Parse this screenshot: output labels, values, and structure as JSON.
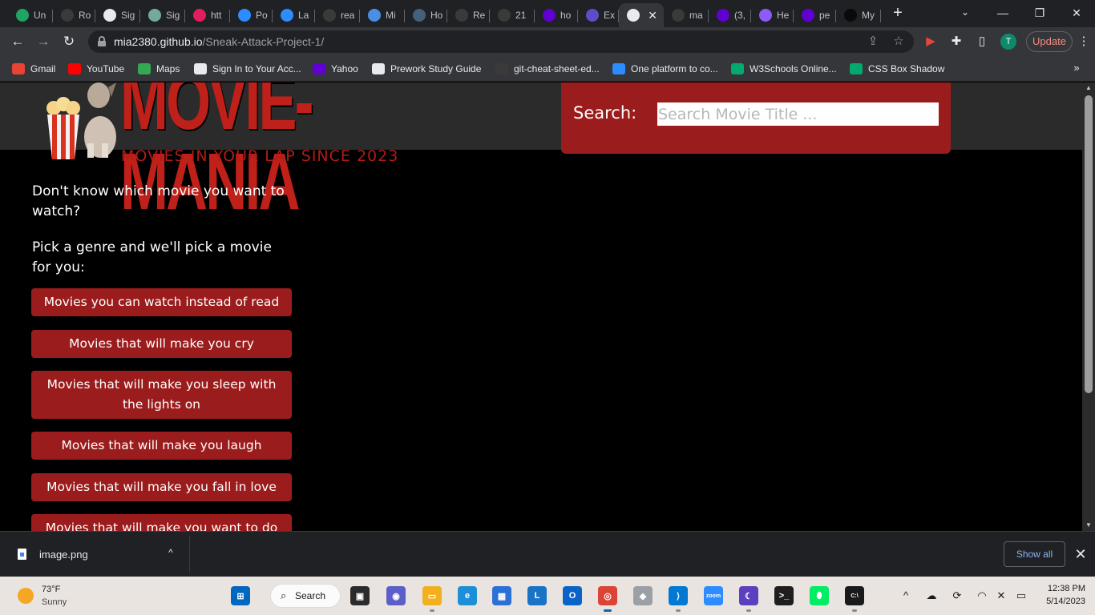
{
  "browser": {
    "tabs": [
      {
        "title": "Un",
        "icon": "google-drive-icon",
        "color": "#1fa463"
      },
      {
        "title": "Ro",
        "icon": "github-icon",
        "color": "#3a3a3a"
      },
      {
        "title": "Sig",
        "icon": "globe-icon",
        "color": "#e8eaed"
      },
      {
        "title": "Sig",
        "icon": "openai-icon",
        "color": "#74aa9c"
      },
      {
        "title": "htt",
        "icon": "slack-icon",
        "color": "#e01e5a"
      },
      {
        "title": "Po",
        "icon": "zoom-icon",
        "color": "#2d8cff"
      },
      {
        "title": "La",
        "icon": "zoom-icon",
        "color": "#2d8cff"
      },
      {
        "title": "rea",
        "icon": "github-icon",
        "color": "#3a3a3a"
      },
      {
        "title": "Mi",
        "icon": "cube-icon",
        "color": "#4a90e2"
      },
      {
        "title": "Ho",
        "icon": "bookmark-icon",
        "color": "#44607a"
      },
      {
        "title": "Re",
        "icon": "github-icon",
        "color": "#3a3a3a"
      },
      {
        "title": "21",
        "icon": "github-icon",
        "color": "#3a3a3a"
      },
      {
        "title": "ho",
        "icon": "yahoo-icon",
        "color": "#6001d2"
      },
      {
        "title": "Ex",
        "icon": "a-circle-icon",
        "color": "#5b4fc9"
      },
      {
        "title": "",
        "icon": "globe-icon",
        "color": "#e8eaed",
        "active": true
      },
      {
        "title": "ma",
        "icon": "github-icon",
        "color": "#3a3a3a"
      },
      {
        "title": "(3,",
        "icon": "yahoo-mail-icon",
        "color": "#6001d2"
      },
      {
        "title": "He",
        "icon": "h-icon",
        "color": "#8b5cf6"
      },
      {
        "title": "pe",
        "icon": "yahoo-icon",
        "color": "#6001d2"
      },
      {
        "title": "My",
        "icon": "dev-icon",
        "color": "#0a0a0a"
      }
    ],
    "new_tab": "+",
    "tab_search": "⌄",
    "window_minimize": "—",
    "window_restore": "❐",
    "window_close": "✕",
    "back": "←",
    "forward": "→",
    "reload": "↻",
    "url_host": "mia2380.github.io",
    "url_path": "/Sneak-Attack-Project-1/",
    "share_icon": "⇪",
    "star_icon": "☆",
    "profile_initial": "T",
    "update_label": "Update",
    "menu": "⋮",
    "bookmarks": [
      {
        "label": "Gmail",
        "icon": "gmail-icon",
        "color": "#ea4335"
      },
      {
        "label": "YouTube",
        "icon": "youtube-icon",
        "color": "#ff0000"
      },
      {
        "label": "Maps",
        "icon": "maps-icon",
        "color": "#34a853"
      },
      {
        "label": "Sign In to Your Acc...",
        "icon": "globe-icon",
        "color": "#e8eaed"
      },
      {
        "label": "Yahoo",
        "icon": "yahoo-mail-icon",
        "color": "#6001d2"
      },
      {
        "label": "Prework Study Guide",
        "icon": "globe-icon",
        "color": "#e8eaed"
      },
      {
        "label": "git-cheat-sheet-ed...",
        "icon": "github-icon",
        "color": "#3a3a3a"
      },
      {
        "label": "One platform to co...",
        "icon": "zoom-icon",
        "color": "#2d8cff"
      },
      {
        "label": "W3Schools Online...",
        "icon": "w3schools-icon",
        "color": "#04aa6d"
      },
      {
        "label": "CSS Box Shadow",
        "icon": "w3schools-icon",
        "color": "#04aa6d"
      }
    ],
    "bookmarks_more": "»"
  },
  "page": {
    "logo_title": "MOVIE-MANIA",
    "logo_tagline": "MOVIES IN YOUR LAP SINCE 2023",
    "search_label": "Search:",
    "search_placeholder": "Search Movie Title ...",
    "intro_text": "Don't know which movie you want to watch?",
    "pick_text": "Pick a genre and we'll pick a movie for you:",
    "genres": [
      "Movies you can watch instead of read",
      "Movies that will make you cry",
      "Movies that will make you sleep with the lights on",
      "Movies that will make you laugh",
      "Movies that will make you fall in love",
      "Movies that will make you want to do"
    ],
    "accent_color": "#9b1c1c"
  },
  "downloads": {
    "file_name": "image.png",
    "show_all": "Show all",
    "close": "✕",
    "caret": "^"
  },
  "taskbar": {
    "temperature": "73°F",
    "condition": "Sunny",
    "search_label": "Search",
    "time": "12:38 PM",
    "date": "5/14/2023",
    "apps": [
      {
        "name": "start-icon",
        "color": "#0067c0",
        "glyph": "⊞"
      },
      {
        "name": "task-view-icon",
        "color": "#2b2b2b",
        "glyph": "▣"
      },
      {
        "name": "teams-chat-icon",
        "color": "#5b5fc7",
        "glyph": "◉"
      },
      {
        "name": "file-explorer-icon",
        "color": "#f2b01e",
        "glyph": "▭"
      },
      {
        "name": "edge-icon",
        "color": "#1d8fd6",
        "glyph": "e"
      },
      {
        "name": "ms-store-icon",
        "color": "#2c6fd6",
        "glyph": "▦"
      },
      {
        "name": "l-app-icon",
        "color": "#1a73c4",
        "glyph": "L"
      },
      {
        "name": "outlook-icon",
        "color": "#0a64c8",
        "glyph": "O"
      },
      {
        "name": "chrome-icon",
        "color": "#db4437",
        "glyph": "◎"
      },
      {
        "name": "gitkraken-icon",
        "color": "#9aa0a6",
        "glyph": "◆"
      },
      {
        "name": "vscode-icon",
        "color": "#0078d4",
        "glyph": "⟩"
      },
      {
        "name": "zoom-app-icon",
        "color": "#2d8cff",
        "glyph": "zoom"
      },
      {
        "name": "moon-app-icon",
        "color": "#5b3fbf",
        "glyph": "☾"
      },
      {
        "name": "terminal-icon",
        "color": "#1e1e1e",
        "glyph": ">_"
      },
      {
        "name": "mongodb-icon",
        "color": "#00ed64",
        "glyph": "⬮"
      },
      {
        "name": "cmd-icon",
        "color": "#1a1a1a",
        "glyph": "C:\\"
      }
    ],
    "tray": [
      {
        "name": "tray-overflow-icon",
        "glyph": "^"
      },
      {
        "name": "onedrive-icon",
        "glyph": "☁"
      },
      {
        "name": "sync-icon",
        "glyph": "⟳"
      },
      {
        "name": "wifi-icon",
        "glyph": "◠"
      },
      {
        "name": "volume-muted-icon",
        "glyph": "✕"
      },
      {
        "name": "battery-icon",
        "glyph": "▭"
      }
    ]
  }
}
